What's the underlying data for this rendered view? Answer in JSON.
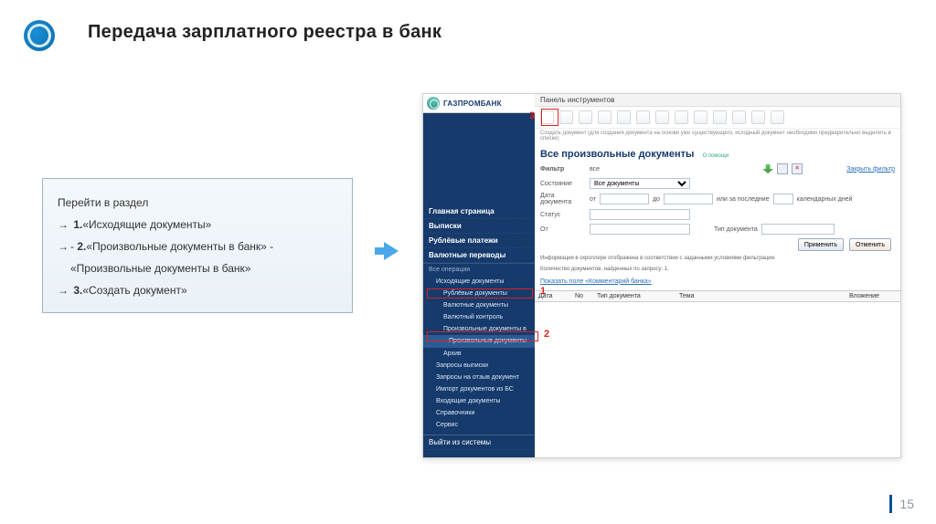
{
  "slide": {
    "title": "Передача зарплатного реестра в банк",
    "page_number": "15"
  },
  "instructions": {
    "heading": "Перейти в раздел",
    "lines": [
      {
        "prefix": "→",
        "text_before": " ",
        "bold": "1.",
        "text_after": "«Исходящие документы»"
      },
      {
        "prefix": "→",
        "text_before": "- ",
        "bold": "2.",
        "text_after": "«Произвольные   документы в банк» -"
      },
      {
        "prefix": "",
        "text_before": "",
        "bold": "",
        "text_after": "«Произвольные документы в банк»"
      },
      {
        "prefix": "→",
        "text_before": " ",
        "bold": "3.",
        "text_after": "«Создать документ»"
      }
    ]
  },
  "app": {
    "brand": "ГАЗПРОМБАНК",
    "main_nav": [
      "Главная страница",
      "Выписки",
      "Рублёвые платежи",
      "Валютные переводы"
    ],
    "ops_header": "Все операции",
    "ops_items": [
      {
        "label": "Исходящие документы",
        "marked": false
      },
      {
        "label": "Рублёвые документы",
        "marked": false,
        "sub": true
      },
      {
        "label": "Валютные документы",
        "marked": false,
        "sub": true
      },
      {
        "label": "Валютный контроль",
        "marked": false,
        "sub": true
      },
      {
        "label": "Произвольные документы в",
        "marked": false,
        "sub": true
      },
      {
        "label": "Произвольные документы",
        "marked": true,
        "sub": true,
        "subsub": true
      },
      {
        "label": "Архив",
        "marked": false,
        "sub": true
      },
      {
        "label": "Запросы выписки",
        "marked": false
      },
      {
        "label": "Запросы на отзыв документ",
        "marked": false
      },
      {
        "label": "Импорт документов из БС",
        "marked": false
      },
      {
        "label": "Входящие документы",
        "marked": false
      },
      {
        "label": "Справочники",
        "marked": false
      },
      {
        "label": "Сервис",
        "marked": false
      }
    ],
    "logout": "Выйти из системы",
    "panel_label": "Панель инструментов",
    "toolbar_hint": "Создать документ (для создания документа на основе уже существующего, исходный документ необходимо предварительно выделить в списке)",
    "section_title": "Все произвольные документы",
    "help": "О помощи",
    "filter_label": "Фильтр",
    "filter_value": "все",
    "state_label": "Состояние",
    "state_value": "Все документы",
    "date_label": "Дата документа",
    "date_from_lbl": "от",
    "date_to_lbl": "до",
    "or_last_lbl": "или за последние",
    "days_lbl": "календарных дней",
    "status_label": "Статус",
    "from_label": "От",
    "doctype_label": "Тип документа",
    "apply": "Применить",
    "cancel": "Отменить",
    "close_filter": "Закрыть фильтр",
    "info1": "Информация в скроллере отображена в соответствии с заданными условиями фильтрации.",
    "info2": "Количество документов, найденных по запросу: 1.",
    "info3": "Показать поле «Комментарий банка»",
    "columns": {
      "date": "Дата",
      "no": "No",
      "type": "Тип документа",
      "subject": "Тема",
      "attach": "Вложение"
    }
  },
  "callouts": {
    "n1": "1",
    "n2": "2",
    "n3": "3"
  }
}
